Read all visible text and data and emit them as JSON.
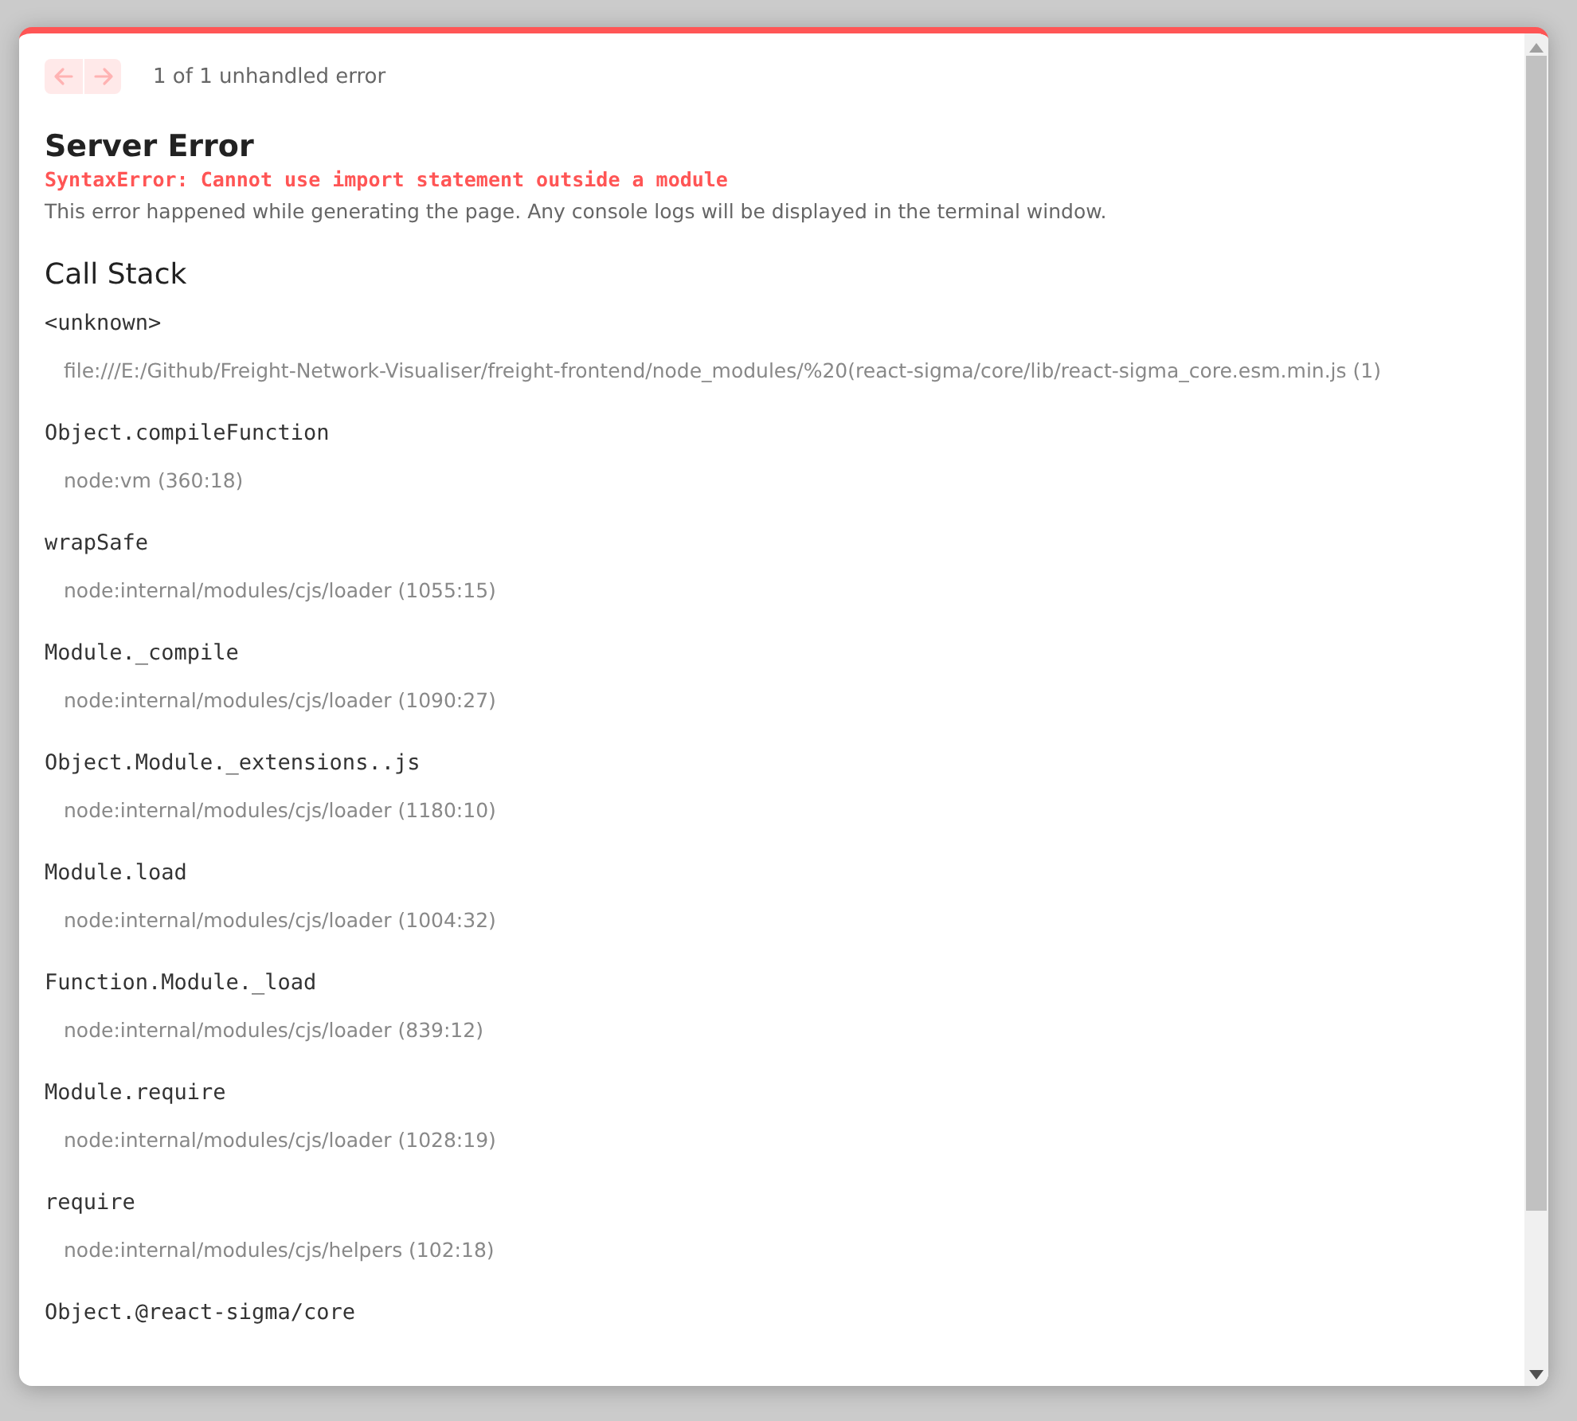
{
  "nav": {
    "prev": {
      "disabled": true
    },
    "next": {
      "disabled": true
    },
    "counter": "1 of 1 unhandled error"
  },
  "title": "Server Error",
  "error_message": "SyntaxError: Cannot use import statement outside a module",
  "description": "This error happened while generating the page. Any console logs will be displayed in the terminal window.",
  "call_stack": {
    "heading": "Call Stack",
    "frames": [
      {
        "function": "<unknown>",
        "location": "file:///E:/Github/Freight-Network-Visualiser/freight-frontend/node_modules/%20(react-sigma/core/lib/react-sigma_core.esm.min.js (1)"
      },
      {
        "function": "Object.compileFunction",
        "location": "node:vm (360:18)"
      },
      {
        "function": "wrapSafe",
        "location": "node:internal/modules/cjs/loader (1055:15)"
      },
      {
        "function": "Module._compile",
        "location": "node:internal/modules/cjs/loader (1090:27)"
      },
      {
        "function": "Object.Module._extensions..js",
        "location": "node:internal/modules/cjs/loader (1180:10)"
      },
      {
        "function": "Module.load",
        "location": "node:internal/modules/cjs/loader (1004:32)"
      },
      {
        "function": "Function.Module._load",
        "location": "node:internal/modules/cjs/loader (839:12)"
      },
      {
        "function": "Module.require",
        "location": "node:internal/modules/cjs/loader (1028:19)"
      },
      {
        "function": "require",
        "location": "node:internal/modules/cjs/helpers (102:18)"
      },
      {
        "function": "Object.@react-sigma/core"
      }
    ]
  }
}
